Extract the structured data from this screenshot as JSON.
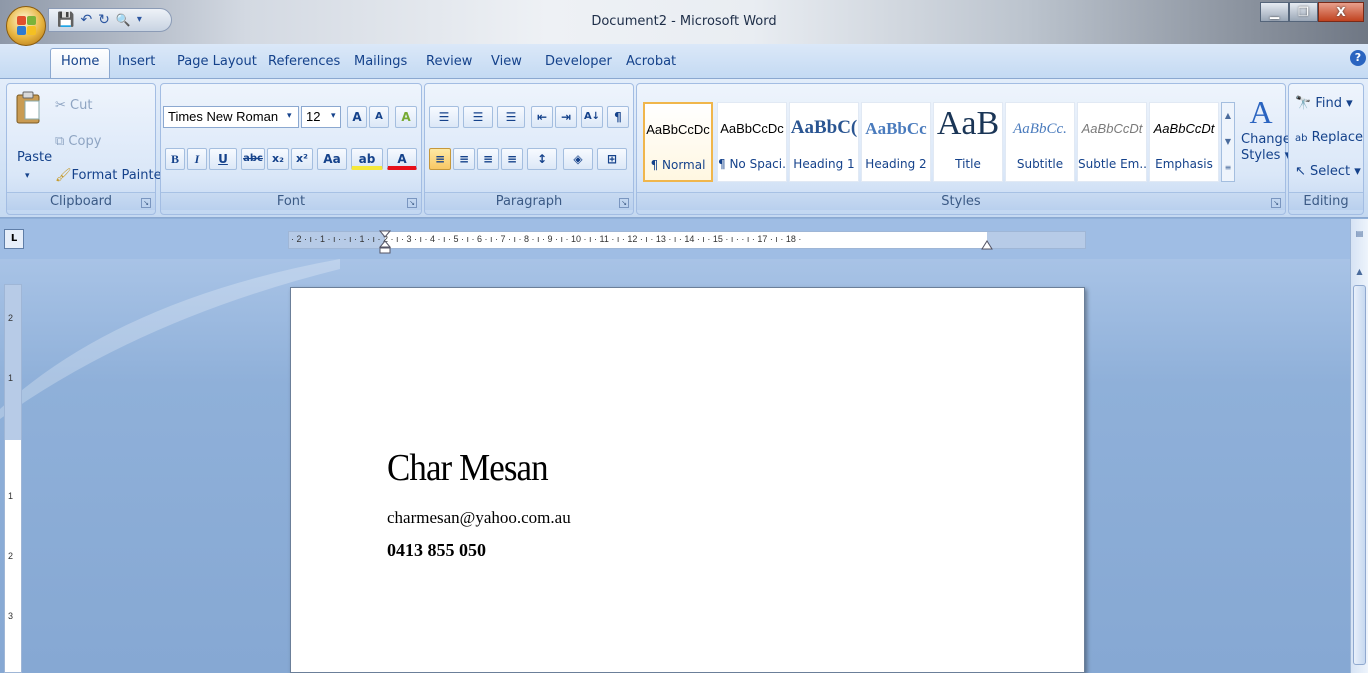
{
  "window": {
    "title": "Document2 - Microsoft Word",
    "minimize_glyph": "▁",
    "maximize_glyph": "❐",
    "close_glyph": "X"
  },
  "quick_access": {
    "icons": [
      "save-icon",
      "undo-icon",
      "redo-icon",
      "print-preview-icon",
      "customize-icon"
    ],
    "glyphs": [
      "💾",
      "↶",
      "↻",
      "🔍",
      "▾"
    ]
  },
  "tabs": [
    "Home",
    "Insert",
    "Page Layout",
    "References",
    "Mailings",
    "Review",
    "View",
    "Developer",
    "Acrobat"
  ],
  "active_tab": "Home",
  "help_glyph": "?",
  "ribbon": {
    "clipboard": {
      "label": "Clipboard",
      "paste": "Paste",
      "paste_arrow": "▾",
      "cut": "Cut",
      "copy": "Copy",
      "format_painter": "Format Painter"
    },
    "font": {
      "label": "Font",
      "font_name": "Times New Roman",
      "font_size": "12",
      "grow": "A",
      "shrink": "A",
      "clear": "A",
      "bold": "B",
      "italic": "I",
      "underline": "U",
      "strike": "abc",
      "subscript": "x₂",
      "superscript": "x²",
      "change_case": "Aa",
      "highlight": "ab",
      "font_color": "A"
    },
    "paragraph": {
      "label": "Paragraph",
      "bullets": "☰",
      "numbering": "☰",
      "multilevel": "☰",
      "decrease_indent": "⇤",
      "increase_indent": "⇥",
      "sort": "A↓",
      "show_marks": "¶",
      "align_left": "≡",
      "center": "≡",
      "align_right": "≡",
      "justify": "≡",
      "line_spacing": "↕",
      "shading": "◈",
      "borders": "⊞"
    },
    "styles": {
      "label": "Styles",
      "items": [
        {
          "sample": "AaBbCcDc",
          "name": "¶ Normal"
        },
        {
          "sample": "AaBbCcDc",
          "name": "¶ No Spaci..."
        },
        {
          "sample": "AaBbC(",
          "name": "Heading 1"
        },
        {
          "sample": "AaBbCc",
          "name": "Heading 2"
        },
        {
          "sample": "AaB",
          "name": "Title"
        },
        {
          "sample": "AaBbCc.",
          "name": "Subtitle"
        },
        {
          "sample": "AaBbCcDt",
          "name": "Subtle Em..."
        },
        {
          "sample": "AaBbCcDt",
          "name": "Emphasis"
        }
      ],
      "change_styles": "Change Styles",
      "change_styles_line1": "Change",
      "change_styles_line2": "Styles"
    },
    "editing": {
      "label": "Editing",
      "find": "Find",
      "replace": "Replace",
      "select": "Select"
    }
  },
  "ruler": {
    "tab_selector": "L",
    "horizontal_text": "· 2 · ı · 1 · ı ·   · ı · 1 · ı · 2 · ı · 3 · ı · 4 · ı · 5 · ı · 6 · ı · 7 · ı · 8 · ı · 9 · ı · 10 · ı · 11 · ı · 12 · ı · 13 · ı · 14 · ı · 15 · ı ·   · ı · 17 · ı · 18 ·",
    "vertical_labels": [
      "2",
      "1",
      "1",
      "2",
      "3"
    ]
  },
  "document": {
    "name": "Char Mesan",
    "email": "charmesan@yahoo.com.au",
    "phone": "0413 855 050"
  },
  "colors": {
    "ribbon_text": "#15428b",
    "accent_orange": "#f0b64c",
    "workspace": "#8fb0d9"
  }
}
